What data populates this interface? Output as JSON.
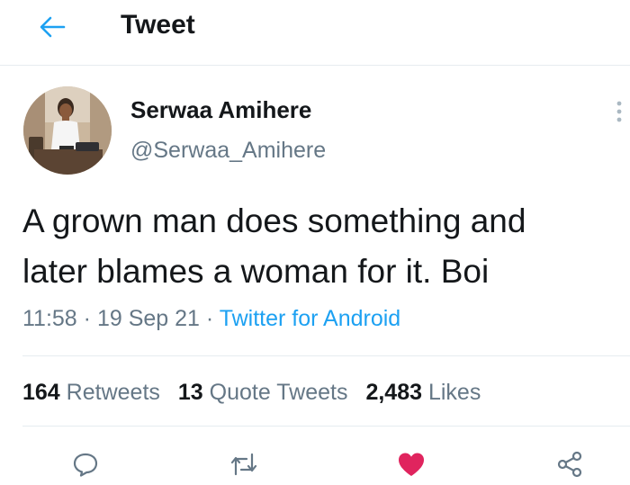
{
  "header": {
    "back_icon": "arrow-left-icon",
    "title": "Tweet"
  },
  "author": {
    "display_name": "Serwaa Amihere",
    "handle": "@Serwaa_Amihere"
  },
  "tweet": {
    "text": "A grown man does something and\nlater blames a woman for it. Boi",
    "time": "11:58",
    "separator": "·",
    "date": "19 Sep 21",
    "source": "Twitter for Android"
  },
  "stats": {
    "retweets_count": "164",
    "retweets_label": "Retweets",
    "quotes_count": "13",
    "quotes_label": "Quote Tweets",
    "likes_count": "2,483",
    "likes_label": "Likes"
  },
  "actions": [
    "reply-icon",
    "retweet-icon",
    "like-icon",
    "share-icon"
  ],
  "colors": {
    "accent": "#1da1f2",
    "secondary_text": "#657786",
    "like": "#e0245e",
    "divider": "#e6ecf0"
  }
}
